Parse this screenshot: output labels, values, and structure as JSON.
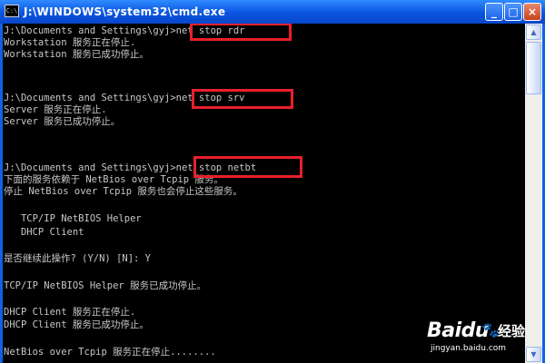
{
  "window": {
    "title": "J:\\WINDOWS\\system32\\cmd.exe",
    "icon_text": "C:\\",
    "controls": {
      "minimize": "_",
      "maximize": "□",
      "close": "×"
    }
  },
  "console": {
    "lines": [
      "J:\\Documents and Settings\\gyj>net stop rdr",
      "Workstation 服务正在停止.",
      "Workstation 服务已成功停止。",
      "",
      "",
      "J:\\Documents and Settings\\gyj>net stop srv",
      "Server 服务正在停止.",
      "Server 服务已成功停止。",
      "",
      "",
      "J:\\Documents and Settings\\gyj>net stop netbt",
      "下面的服务依赖于 NetBios over Tcpip 服务。",
      "停止 NetBios over Tcpip 服务也会停止这些服务。",
      "",
      "   TCP/IP NetBIOS Helper",
      "   DHCP Client",
      "",
      "是否继续此操作? (Y/N) [N]: Y",
      "",
      "TCP/IP NetBIOS Helper 服务已成功停止。",
      "",
      "DHCP Client 服务正在停止.",
      "DHCP Client 服务已成功停止。",
      "",
      "NetBios over Tcpip 服务正在停止........"
    ]
  },
  "scrollbar": {
    "up_arrow": "▲",
    "down_arrow": "▼"
  },
  "watermark": {
    "brand": "Baidu",
    "paw": "🐾",
    "jingyan": "经验",
    "url": "jingyan.baidu.com"
  }
}
